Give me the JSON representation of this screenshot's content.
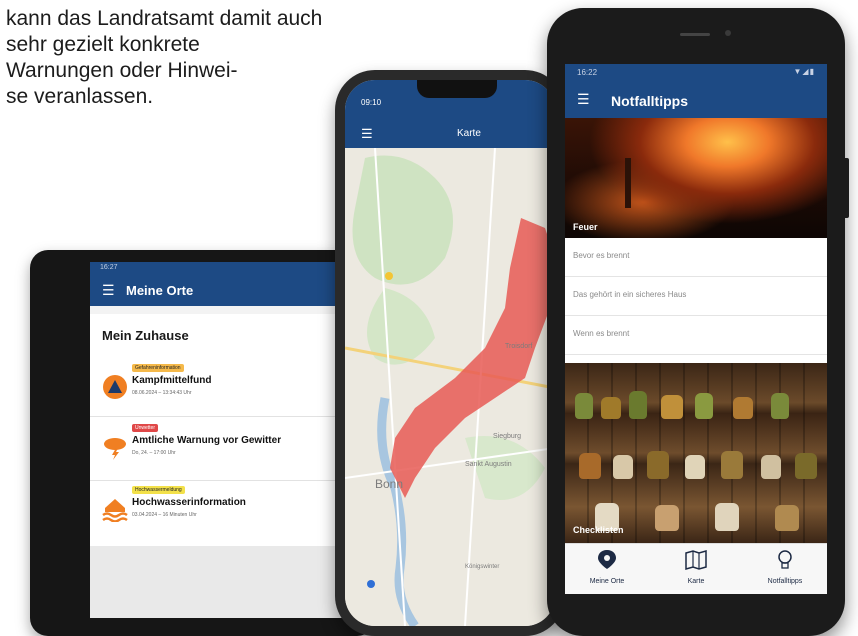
{
  "intro": {
    "lines": [
      "kann das Landratsamt damit auch",
      "sehr gezielt konkrete",
      "Warnungen oder Hinwei-",
      "se veranlassen."
    ]
  },
  "tablet": {
    "status_time": "16:27",
    "header_title": "Meine Orte",
    "section_title": "Mein Zuhause",
    "items": [
      {
        "badge": "Gefahreninformation",
        "title": "Kampfmittelfund",
        "subtitle": "08.06.2024 – 13:34:43 Uhr",
        "icon": "warning-triangle-icon"
      },
      {
        "badge": "Unwetter",
        "title": "Amtliche Warnung vor Gewitter",
        "subtitle": "Do, 24. – 17:00 Uhr",
        "icon": "thunderstorm-icon"
      },
      {
        "badge": "Hochwassermeldung",
        "title": "Hochwasserinformation",
        "subtitle": "03.04.2024 – 16 Minuten Uhr",
        "icon": "flood-house-icon"
      }
    ],
    "colors": {
      "header": "#1d4a84",
      "badge_orange": "#f5b94a",
      "badge_red": "#e04848",
      "badge_yellow": "#f3e14a",
      "icon_orange": "#f07f22"
    }
  },
  "map_phone": {
    "status_time": "09:10",
    "header_title": "Karte",
    "map_labels": [
      "Bonn",
      "Siegburg",
      "Sankt Augustin",
      "Troisdorf",
      "Königswinter"
    ],
    "alert_color": "#e85a55"
  },
  "tips_phone": {
    "status_time": "16:22",
    "status_icons": "▼◢▮",
    "header_title": "Notfalltipps",
    "topics": [
      {
        "caption": "Feuer"
      },
      {
        "caption": "Checklisten"
      }
    ],
    "list_items": [
      "Bevor es brennt",
      "Das gehört in ein sicheres Haus",
      "Wenn es brennt"
    ],
    "tabs": [
      {
        "label": "Meine Orte",
        "icon": "location-pin-icon"
      },
      {
        "label": "Karte",
        "icon": "map-icon"
      },
      {
        "label": "Notfalltipps",
        "icon": "lightbulb-icon"
      }
    ]
  }
}
